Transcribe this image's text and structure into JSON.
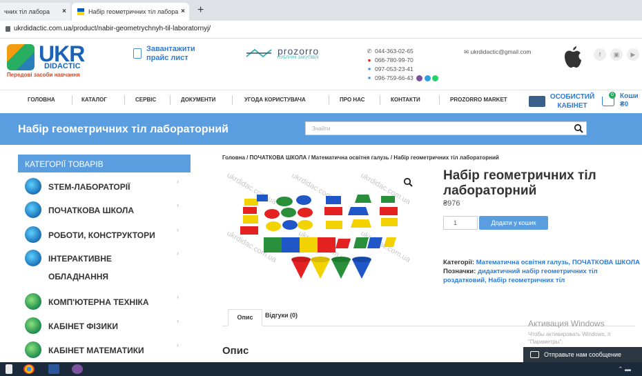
{
  "browser": {
    "tab1_label": "чних тіл лабора",
    "tab2_label": "Набір геометричних тіл лабора",
    "tab_close": "×",
    "new_tab": "+",
    "url": "ukrdidactic.com.ua/product/nabir-geometrychnyh-til-laboratornyj/"
  },
  "header": {
    "logo_main": "UKR",
    "logo_sub": "DIDACTIC",
    "logo_tagline": "Передові засоби навчання",
    "price_list": "Завантажити прайс лист",
    "prozorro_name": "prozorro",
    "prozorro_sub": "ПУБЛІЧНІ ЗАКУПІВЛІ",
    "phones": [
      "044-363-02-65",
      "066-780-99-70",
      "097-053-23-41",
      "096-759-66-43"
    ],
    "email": "ukrdidactic@gmail.com",
    "social": [
      "f",
      "▣",
      "▶"
    ]
  },
  "nav": {
    "items": [
      "ГОЛОВНА",
      "КАТАЛОГ",
      "СЕРВІС",
      "ДОКУМЕНТИ",
      "УГОДА КОРИСТУВАЧА",
      "ПРО НАС",
      "КОНТАКТИ",
      "PROZORRO MARKET"
    ],
    "account_line1": "ОСОБИСТИЙ",
    "account_line2": "КАБІНЕТ",
    "cart_count": "0",
    "cart_label": "Коши",
    "cart_total": "₴0"
  },
  "band": {
    "title": "Набір геометричних тіл лабораторний",
    "search_placeholder": "Знайти"
  },
  "sidebar": {
    "header": "КАТЕГОРІЇ ТОВАРІВ",
    "items": [
      {
        "label": "STEM-ЛАБОРАТОРІЇ",
        "label2": ""
      },
      {
        "label": "ПОЧАТКОВА ШКОЛА",
        "label2": ""
      },
      {
        "label": "РОБОТИ, КОНСТРУКТОРИ",
        "label2": ""
      },
      {
        "label": "ІНТЕРАКТИВНЕ",
        "label2": "ОБЛАДНАННЯ"
      },
      {
        "label": "КОМП'ЮТЕРНА ТЕХНІКА",
        "label2": ""
      },
      {
        "label": "КАБІНЕТ ФІЗИКИ",
        "label2": ""
      },
      {
        "label": "КАБІНЕТ МАТЕМАТИКИ",
        "label2": ""
      }
    ],
    "chevron": "›"
  },
  "product": {
    "breadcrumb": "Головна / ПОЧАТКОВА ШКОЛА / Математична освітня галузь / Набір геометричних тіл лабораторний",
    "title": "Набір геометричних тіл лабораторний",
    "price": "₴976",
    "qty": "1",
    "buy_label": "Додати у кошик",
    "categories_key": "Категорії:",
    "categories": "Математична освітня галузь, ПОЧАТКОВА ШКОЛА",
    "tags_key": "Позначки:",
    "tags": "дидактичний набір геометричних тіл роздатковий, Набір геометричних тіл",
    "watermark": "ukrdidac.com.ua",
    "tab_desc": "Опис",
    "tab_reviews": "Відгуки (0)",
    "desc_heading": "Опис"
  },
  "windows": {
    "activation_title": "Активация Windows",
    "activation_line1": "Чтобы активировать Windows, п",
    "activation_line2": "\"Параметры\".",
    "chat_label": "Отправьте нам сообщение"
  },
  "colors": {
    "accent": "#5b9ee0",
    "link": "#2e7bd6",
    "logo": "#1c63b7"
  }
}
